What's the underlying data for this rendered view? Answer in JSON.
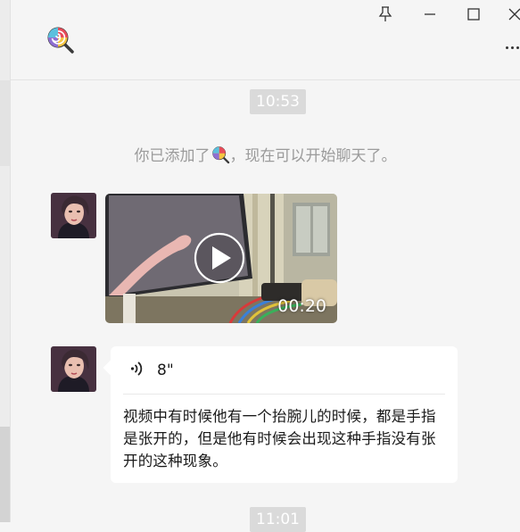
{
  "header": {
    "contact_icon": "lollipop-icon",
    "window_controls": [
      "pin-icon",
      "minimize-icon",
      "maximize-icon",
      "close-icon"
    ],
    "more_icon": "more-icon"
  },
  "messages": {
    "time1": "10:53",
    "system_prefix": "你已添加了",
    "system_suffix": "，现在可以开始聊天了。",
    "video_duration": "00:20",
    "voice_duration": "8\"",
    "transcript": "视频中有时候他有一个抬腕儿的时候，都是手指是张开的，但是他有时候会出现这种手指没有张开的这种现象。",
    "time2": "11:01"
  },
  "colors": {
    "background": "#f5f5f5",
    "bubble": "#ffffff",
    "time_pill": "#dadada",
    "system_text": "#9b9b9b"
  }
}
